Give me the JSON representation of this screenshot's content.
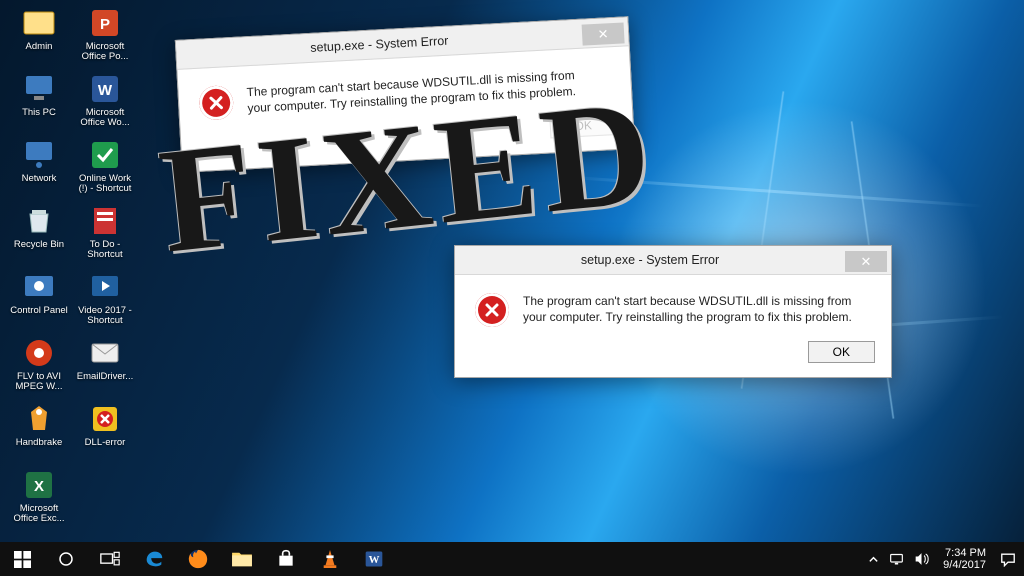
{
  "desktop": {
    "col1": [
      {
        "name": "admin",
        "label": "Admin"
      },
      {
        "name": "this-pc",
        "label": "This PC"
      },
      {
        "name": "network",
        "label": "Network"
      },
      {
        "name": "recycle-bin",
        "label": "Recycle Bin"
      },
      {
        "name": "control-panel",
        "label": "Control Panel"
      },
      {
        "name": "flv-to-avi",
        "label": "FLV to AVI MPEG W..."
      },
      {
        "name": "handbrake",
        "label": "Handbrake"
      },
      {
        "name": "excel",
        "label": "Microsoft Office Exc..."
      }
    ],
    "col2": [
      {
        "name": "powerpoint",
        "label": "Microsoft Office Po..."
      },
      {
        "name": "word",
        "label": "Microsoft Office Wo..."
      },
      {
        "name": "online-work",
        "label": "Online Work (!) - Shortcut"
      },
      {
        "name": "todo",
        "label": "To Do - Shortcut"
      },
      {
        "name": "video-2017",
        "label": "Video 2017 - Shortcut"
      },
      {
        "name": "emaildriver",
        "label": "EmailDriver..."
      },
      {
        "name": "dll-error",
        "label": "DLL-error"
      }
    ]
  },
  "dialog1": {
    "title": "setup.exe - System Error",
    "message": "The program can't start because WDSUTIL.dll is missing from your computer. Try reinstalling the program to fix this problem."
  },
  "dialog2": {
    "title": "setup.exe - System Error",
    "message": "The program can't start because WDSUTIL.dll is missing from your computer. Try reinstalling the program to fix this problem.",
    "ok": "OK"
  },
  "overlay": {
    "fixed": "FIXED"
  },
  "taskbar": {
    "time": "7:34 PM",
    "date": "9/4/2017"
  }
}
